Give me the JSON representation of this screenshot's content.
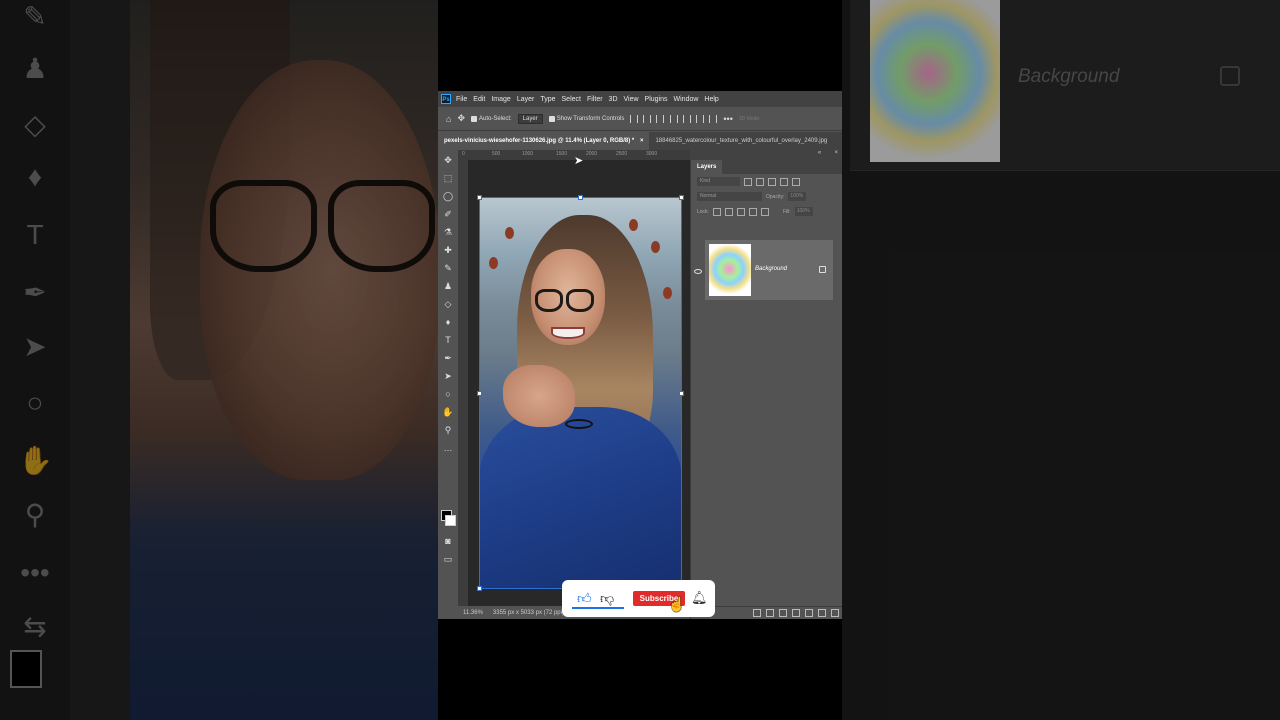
{
  "menu": {
    "items": [
      "File",
      "Edit",
      "Image",
      "Layer",
      "Type",
      "Select",
      "Filter",
      "3D",
      "View",
      "Plugins",
      "Window",
      "Help"
    ]
  },
  "options": {
    "auto_select_label": "Auto-Select:",
    "target_value": "Layer",
    "show_transform_label": "Show Transform Controls",
    "mode_3d_label": "3D Mode:"
  },
  "tabs": {
    "active": "pexels-vinicius-wiesehofer-1130626.jpg @ 11.4% (Layer 0, RGB/8) *",
    "close": "×",
    "second": "18846825_watercolour_texture_with_colourful_overlay_2409.jpg"
  },
  "ruler": {
    "top_ticks": [
      "0",
      "500",
      "1000",
      "1500",
      "2000",
      "2500",
      "3000"
    ]
  },
  "status": {
    "zoom": "11.36%",
    "doc_info": "3355 px x 5033 px (72 ppi)"
  },
  "layers_panel": {
    "tab_label": "Layers",
    "kind_placeholder": "Kind",
    "blend_mode": "Normal",
    "opacity_label": "Opacity:",
    "opacity_value": "100%",
    "lock_label": "Lock:",
    "fill_label": "Fill:",
    "fill_value": "100%",
    "layer_name": "Background"
  },
  "background_panel": {
    "layer_name": "Background"
  },
  "overlay": {
    "subscribe_label": "Subscribe"
  },
  "colors": {
    "photoshop_blue": "#31a8ff",
    "subscribe_red": "#e02b2b",
    "like_blue": "#1a73e8",
    "panel_gray": "#535353"
  }
}
